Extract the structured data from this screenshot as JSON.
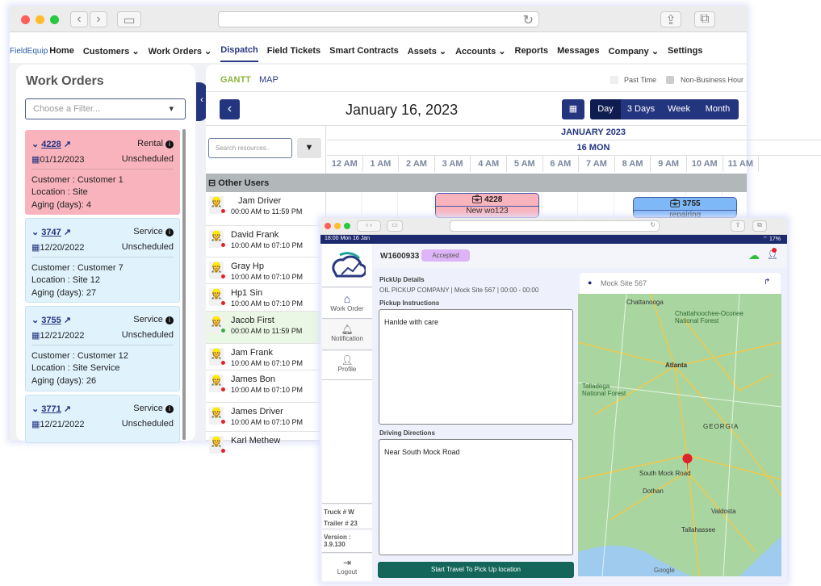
{
  "back_window": {
    "nav": {
      "logo": "FieldEquip",
      "items": [
        "Home",
        "Customers ⌄",
        "Work Orders ⌄",
        "Dispatch",
        "Field Tickets",
        "Smart Contracts",
        "Assets ⌄",
        "Accounts ⌄",
        "Reports",
        "Messages",
        "Company ⌄",
        "Settings"
      ],
      "active": "Dispatch"
    },
    "work_orders": {
      "title": "Work Orders",
      "filter_placeholder": "Choose a Filter...",
      "cards": [
        {
          "id": "4228",
          "type": "Rental",
          "date": "01/12/2023",
          "status": "Unscheduled",
          "customer": "Customer : Customer 1",
          "location": "Location : Site",
          "aging": "Aging (days): 4",
          "color": "#f9b3bd"
        },
        {
          "id": "3747",
          "type": "Service",
          "date": "12/20/2022",
          "status": "Unscheduled",
          "customer": "Customer : Customer 7",
          "location": "Location : Site 12",
          "aging": "Aging (days): 27",
          "color": "#e0f3fd"
        },
        {
          "id": "3755",
          "type": "Service",
          "date": "12/21/2022",
          "status": "Unscheduled",
          "customer": "Customer : Customer 12",
          "location": "Location : Site Service",
          "aging": "Aging (days): 26",
          "color": "#e0f3fd"
        },
        {
          "id": "3771",
          "type": "Service",
          "date": "12/21/2022",
          "status": "Unscheduled",
          "color": "#e0f3fd"
        }
      ]
    },
    "gantt": {
      "tabs": [
        "GANTT",
        "MAP"
      ],
      "legend": [
        "Past Time",
        "Non-Business Hour"
      ],
      "date": "January 16, 2023",
      "views": [
        "Day",
        "3 Days",
        "Week",
        "Month"
      ],
      "active_view": "Day",
      "search_placeholder": "Search resources..",
      "month": "JANUARY 2023",
      "day": "16 MON",
      "hours": [
        "12 AM",
        "1 AM",
        "2 AM",
        "3 AM",
        "4 AM",
        "5 AM",
        "6 AM",
        "7 AM",
        "8 AM",
        "9 AM",
        "10 AM",
        "11 AM"
      ],
      "group": "Other Users",
      "resources": [
        {
          "name": "Jam Driver",
          "time": "00:00 AM to 11:59 PM",
          "status": "red"
        },
        {
          "name": "David Frank",
          "time": "10:00 AM to 07:10 PM",
          "status": "red"
        },
        {
          "name": "Gray Hp",
          "time": "10:00 AM to 07:10 PM",
          "status": "red"
        },
        {
          "name": "Hp1 Sin",
          "time": "10:00 AM to 07:10 PM",
          "status": "red"
        },
        {
          "name": "Jacob First",
          "time": "00:00 AM to 11:59 PM",
          "status": "green"
        },
        {
          "name": "Jam Frank",
          "time": "10:00 AM to 07:10 PM",
          "status": "red"
        },
        {
          "name": "James Bon",
          "time": "10:00 AM to 07:10 PM",
          "status": "red"
        },
        {
          "name": "James Driver",
          "time": "10:00 AM to 07:10 PM",
          "status": "red"
        },
        {
          "name": "Karl Methew",
          "time": "",
          "status": "red"
        }
      ],
      "events": [
        {
          "id": "4228",
          "label": "New wo123",
          "color": "#f9b3bd"
        },
        {
          "id": "3755",
          "label": "repairing",
          "color": "#7fb8f7"
        }
      ]
    }
  },
  "front_window": {
    "status_bar": {
      "time": "18:00  Mon 16 Jan",
      "battery": "17%"
    },
    "wo_id": "W1600933",
    "badge": "Accepted",
    "sidebar": {
      "items": [
        "Work Order",
        "Notification",
        "Profile"
      ],
      "truck": "Truck # W",
      "trailer": "Trailer # 23",
      "version": "Version : 3.9.130",
      "logout": "Logout"
    },
    "pickup_details_label": "PickUp Details",
    "pickup_details": "OIL PICKUP COMPANY | Mock Site 567 | 00:00 - 00:00",
    "pickup_instructions_label": "Pickup Instructions",
    "pickup_instructions": "Hanlde with care",
    "driving_directions_label": "Driving Directions",
    "driving_directions": "Near South Mock Road",
    "start_button": "Start Travel To Pick Up location",
    "map": {
      "site": "Mock Site 567",
      "labels": [
        "Chattanooga",
        "Atlanta",
        "GEORGIA",
        "South Mock Road",
        "Tallahassee",
        "Valdosta",
        "Dothan",
        "Talladega National Forest",
        "Chattahoochee-Oconee National Forest",
        "Google"
      ]
    }
  }
}
